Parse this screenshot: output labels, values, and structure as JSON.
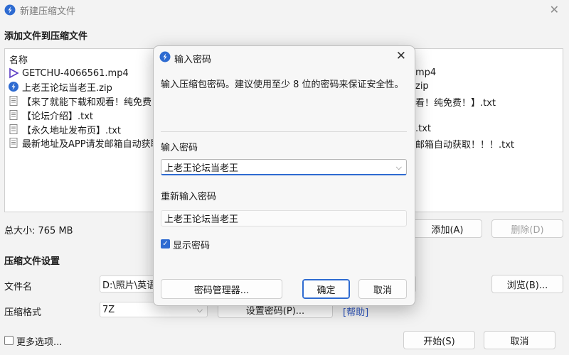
{
  "window": {
    "title": "新建压缩文件"
  },
  "add_section": {
    "title": "添加文件到压缩文件",
    "column_header": "名称",
    "files": [
      {
        "name": "GETCHU-4066561.mp4",
        "icon": "video-file-icon",
        "tail": "mp4"
      },
      {
        "name": "上老王论坛当老王.zip",
        "icon": "zip-file-icon",
        "tail": "zip"
      },
      {
        "name": "【来了就能下载和观看！纯免费！",
        "icon": "text-file-icon",
        "tail": "看！纯免费！】.txt"
      },
      {
        "name": "【论坛介绍】.txt",
        "icon": "text-file-icon",
        "tail": ""
      },
      {
        "name": "【永久地址发布页】.txt",
        "icon": "text-file-icon",
        "tail": ".txt"
      },
      {
        "name": "最新地址及APP请发邮箱自动获取",
        "icon": "text-file-icon",
        "tail": "邮箱自动获取！！！.txt"
      }
    ],
    "total_size": "总大小: 765 MB",
    "add_button": "添加(A)",
    "delete_button": "删除(D)"
  },
  "settings": {
    "title": "压缩文件设置",
    "filename_label": "文件名",
    "filename_value": "D:\\照片\\英语",
    "browse_button": "浏览(B)...",
    "format_label": "压缩格式",
    "format_value": "7Z",
    "set_password_button": "设置密码(P)...",
    "help_link": "[帮助]"
  },
  "footer": {
    "more_options": "更多选项...",
    "start_button": "开始(S)",
    "cancel_button": "取消"
  },
  "dialog": {
    "title": "输入密码",
    "message": "输入压缩包密码。建议使用至少 8 位的密码来保证安全性。",
    "password_label": "输入密码",
    "password_value": "上老王论坛当老王",
    "reenter_label": "重新输入密码",
    "reenter_value": "上老王论坛当老王",
    "show_password_label": "显示密码",
    "show_password_checked": true,
    "manager_button": "密码管理器...",
    "ok_button": "确定",
    "cancel_button": "取消"
  },
  "colors": {
    "accent": "#2e6bd1",
    "link": "#2a52be"
  }
}
